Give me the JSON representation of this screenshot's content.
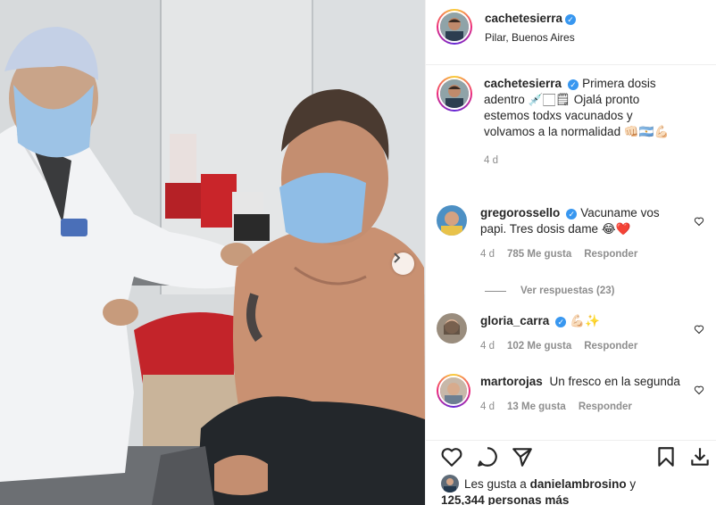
{
  "post": {
    "author": "cachetesierra",
    "location": "Pilar, Buenos Aires"
  },
  "caption": {
    "author": "cachetesierra",
    "text": "Primera dosis adentro 💉🏻🗒 Ojalá pronto estemos todxs vacunados y volvamos a la normalidad 👊🏻🇦🇷💪🏻",
    "age": "4 d"
  },
  "comments": [
    {
      "author": "gregorossello",
      "verified": true,
      "text": "Vacuname vos papi. Tres dosis dame 😂❤️",
      "age": "4 d",
      "likes": "785 Me gusta",
      "reply": "Responder"
    },
    {
      "author": "gloria_carra",
      "verified": true,
      "text": "💪🏻✨",
      "age": "4 d",
      "likes": "102 Me gusta",
      "reply": "Responder"
    },
    {
      "author": "martorojas",
      "verified": false,
      "text": "Un fresco en la segunda",
      "age": "4 d",
      "likes": "13 Me gusta",
      "reply": "Responder"
    }
  ],
  "view_replies": "Ver respuestas (23)",
  "likes": {
    "prefix": "Les gusta a",
    "user": "danielambrosino",
    "conj": "y",
    "count": "125,344 personas más"
  },
  "icons": {
    "verified": "✓",
    "heart": "heart-icon",
    "comment": "comment-icon",
    "share": "share-icon",
    "save": "bookmark-icon",
    "download": "download-icon",
    "next": "chevron-right-icon"
  },
  "colors": {
    "verified": "#3897f0",
    "secondary_text": "#8e8e8e",
    "heart_red": "#ed4956"
  }
}
